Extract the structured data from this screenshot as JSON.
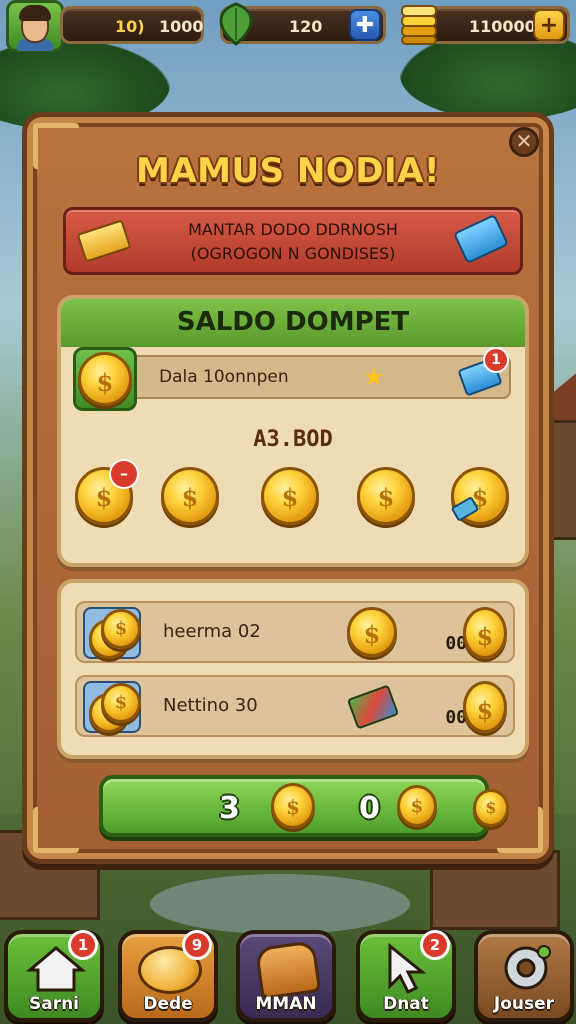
{
  "topbar": {
    "stat_1": "10)",
    "stat_2": "1000",
    "leaf_value": "120",
    "coin_value": "110000",
    "puzzle_icon": "puzzle-icon",
    "plus_icon": "plus-icon"
  },
  "panel": {
    "title": "MAMUS NODIA!",
    "banner_line1": "MANTAR DODO DDRNOSH",
    "banner_line2": "(OGROGON N GONDISES)"
  },
  "wallet": {
    "title": "SALDO DOMPET",
    "row_label": "Dala 10onnpen",
    "row_badge": "1",
    "amount": "A3.BOD",
    "coin_symbol": "$",
    "coin_count": 5
  },
  "history": {
    "rows": [
      {
        "label": "heerma 02",
        "value": "00"
      },
      {
        "label": "Nettino 30",
        "value": "00"
      }
    ]
  },
  "action_bar": {
    "left_value": "3",
    "right_value": "0"
  },
  "nav": [
    {
      "label": "Sarni",
      "badge": "1",
      "color": "#4fa02a"
    },
    {
      "label": "Dede",
      "badge": "9",
      "color": "#d08a2a"
    },
    {
      "label": "MMAN",
      "badge": "",
      "color": "#5a4a7a"
    },
    {
      "label": "Dnat",
      "badge": "2",
      "color": "#4fa02a"
    },
    {
      "label": "Jouser",
      "badge": "",
      "color": "#8a5a2c"
    }
  ],
  "colors": {
    "title_gold": "#ffd34a",
    "panel_wood": "#b9733f",
    "wallet_green": "#7fc04a",
    "badge_red": "#d93a2a"
  }
}
